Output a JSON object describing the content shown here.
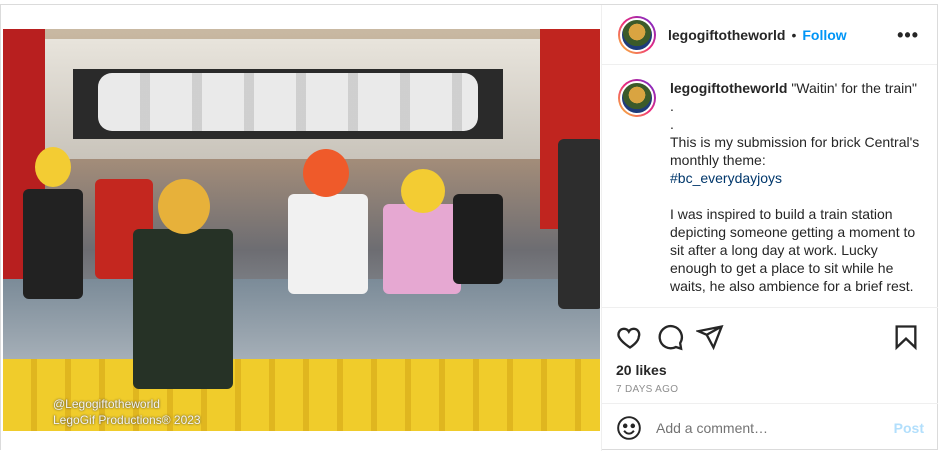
{
  "media": {
    "watermark_handle": "@Legogiftotheworld",
    "watermark_credit": "LegoGif Productions® 2023"
  },
  "header": {
    "username": "legogiftotheworld",
    "separator": "•",
    "follow_label": "Follow",
    "more_label": "•••"
  },
  "caption": {
    "username": "legogiftotheworld",
    "lines": [
      "\"Waitin' for the train\"",
      ".",
      ".",
      "This is my submission for brick Central's monthly theme:",
      "#bc_everydayjoys",
      "",
      "I was inspired to build a train station depicting someone getting a moment to sit after a long day at work. Lucky enough to get a place to sit while he waits, he also ambience for a brief rest."
    ]
  },
  "actions": {
    "likes": "20 likes",
    "time_ago": "7 DAYS AGO"
  },
  "comment": {
    "placeholder": "Add a comment…",
    "post_label": "Post"
  },
  "colors": {
    "accent": "#0095f6",
    "post_disabled": "#b2dffc",
    "hashtag": "#00376b"
  }
}
